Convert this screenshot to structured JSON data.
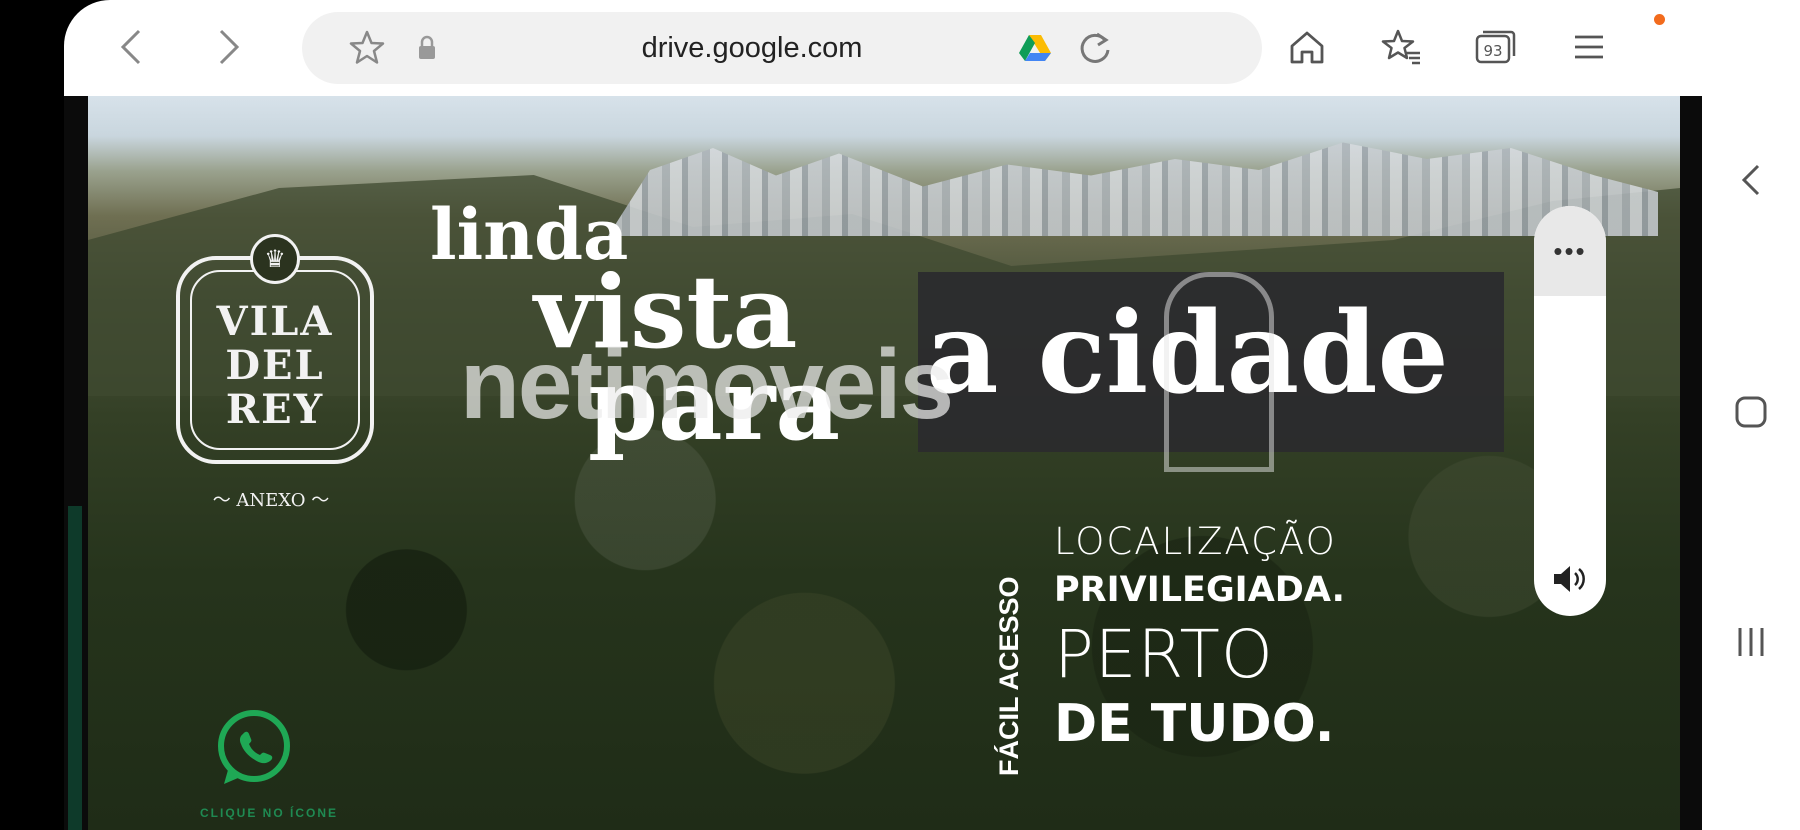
{
  "browser": {
    "url": "drive.google.com",
    "tab_count": "93"
  },
  "ad": {
    "logo": {
      "line1": "VILA",
      "line2": "DEL",
      "line3": "REY",
      "annex": "ANEXO"
    },
    "headline": {
      "line1": "linda",
      "line2": "vista",
      "line3": "para",
      "line4": "a cidade"
    },
    "watermark": "netimoveis",
    "vertical_label": "FÁCIL ACESSO",
    "features": {
      "line1": "LOCALIZAÇÃO",
      "line2": "PRIVILEGIADA.",
      "line3": "PERTO",
      "line4": "DE TUDO."
    },
    "whatsapp_label": "CLIQUE NO ÍCONE"
  },
  "video_controls": {
    "more": "•••"
  },
  "colors": {
    "notification_dot": "#f26b1d",
    "whatsapp_green": "#1fa855",
    "headline_box": "#2a2a2e"
  }
}
